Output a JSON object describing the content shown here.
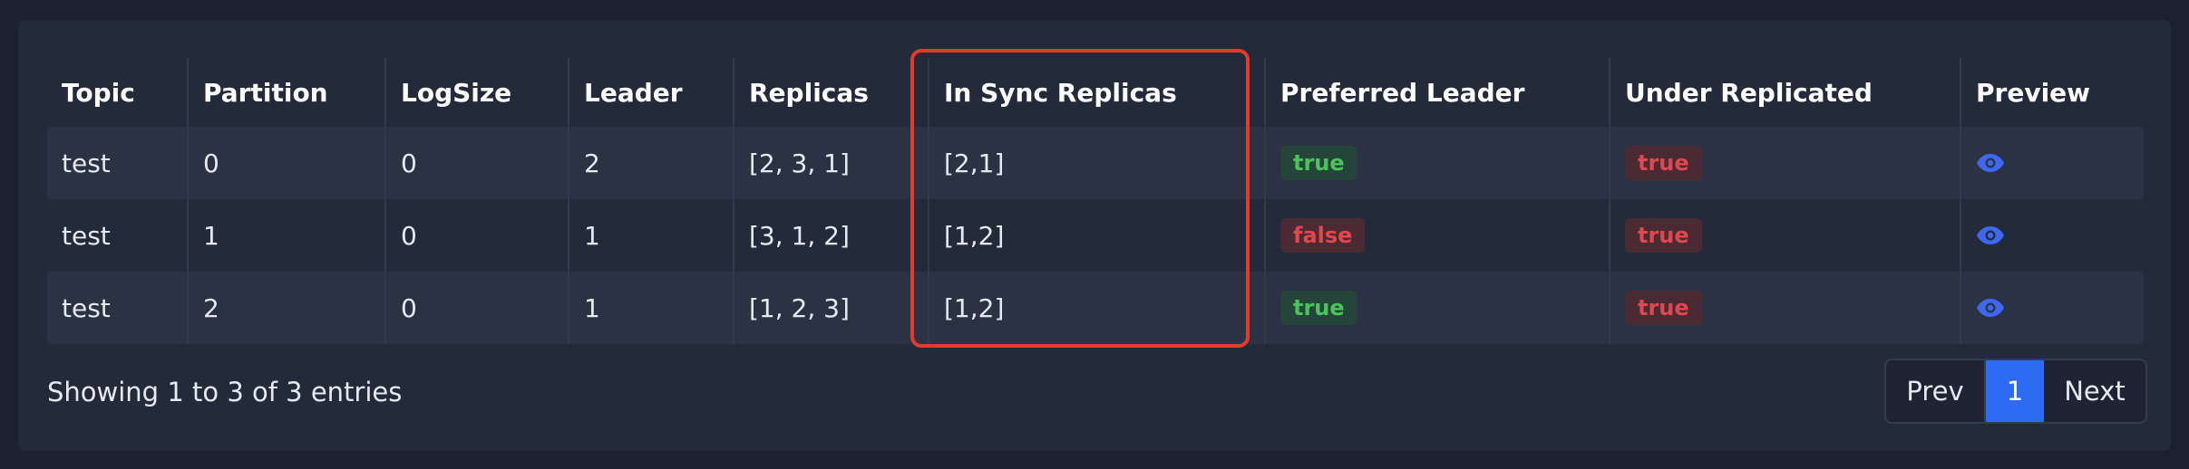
{
  "table": {
    "headers": [
      "Topic",
      "Partition",
      "LogSize",
      "Leader",
      "Replicas",
      "In Sync Replicas",
      "Preferred Leader",
      "Under Replicated",
      "Preview"
    ],
    "rows": [
      {
        "topic": "test",
        "partition": "0",
        "logsize": "0",
        "leader": "2",
        "replicas": "[2, 3, 1]",
        "isr": "[2,1]",
        "preferred_leader": "true",
        "under_replicated": "true",
        "preview_icon": "eye-icon"
      },
      {
        "topic": "test",
        "partition": "1",
        "logsize": "0",
        "leader": "1",
        "replicas": "[3, 1, 2]",
        "isr": "[1,2]",
        "preferred_leader": "false",
        "under_replicated": "true",
        "preview_icon": "eye-icon"
      },
      {
        "topic": "test",
        "partition": "2",
        "logsize": "0",
        "leader": "1",
        "replicas": "[1, 2, 3]",
        "isr": "[1,2]",
        "preferred_leader": "true",
        "under_replicated": "true",
        "preview_icon": "eye-icon"
      }
    ]
  },
  "footer": {
    "info": "Showing 1 to 3 of 3 entries"
  },
  "pagination": {
    "prev": "Prev",
    "current": "1",
    "next": "Next"
  },
  "colors": {
    "highlight_border": "#e23a2b",
    "true_badge": "#4cc35c",
    "false_badge": "#e0474f",
    "accent": "#2d6cf2"
  }
}
